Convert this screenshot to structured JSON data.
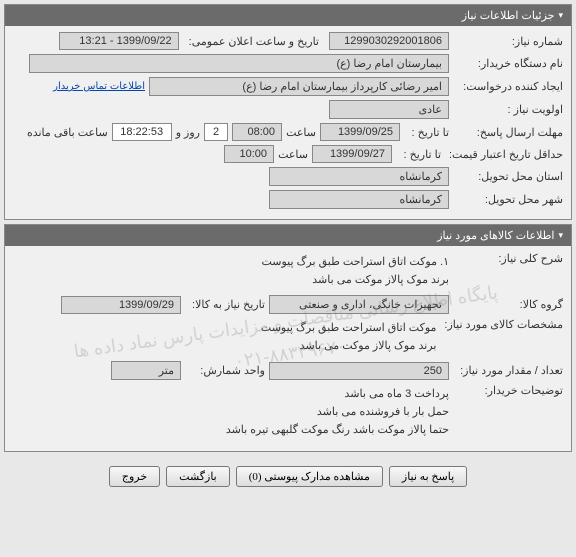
{
  "panel1": {
    "title": "جزئیات اطلاعات نیاز",
    "rows": {
      "req_no_label": "شماره نیاز:",
      "req_no_value": "1299030292001806",
      "pub_time_label": "تاریخ و ساعت اعلان عمومی:",
      "pub_time_value": "1399/09/22 - 13:21",
      "buyer_label": "نام دستگاه خریدار:",
      "buyer_value": "بیمارستان امام رضا (ع)",
      "creator_label": "ایجاد کننده درخواست:",
      "creator_value": "امیر رضائی کارپرداز بیمارستان امام رضا (ع)",
      "contact_link": "اطلاعات تماس خریدار",
      "priority_label": "اولویت نیاز :",
      "priority_value": "عادی",
      "deadline_label": "مهلت ارسال پاسخ:",
      "deadline_to": "تا تاریخ :",
      "deadline_date": "1399/09/25",
      "deadline_time_label": "ساعت",
      "deadline_time": "08:00",
      "remain_days": "2",
      "remain_day_label": "روز و",
      "remain_time": "18:22:53",
      "remain_suffix": "ساعت باقی مانده",
      "validity_label": "حداقل تاریخ اعتبار قیمت:",
      "validity_to": "تا تاریخ :",
      "validity_date": "1399/09/27",
      "validity_time_label": "ساعت",
      "validity_time": "10:00",
      "province_label": "استان محل تحویل:",
      "province_value": "کرمانشاه",
      "city_label": "شهر محل تحویل:",
      "city_value": "کرمانشاه"
    }
  },
  "panel2": {
    "title": "اطلاعات کالاهای مورد نیاز",
    "rows": {
      "desc_label": "شرح کلی نیاز:",
      "desc_line1": "۱. موکت اتاق استراحت طبق برگ پیوست",
      "desc_line2": "برند موک پالاز موکت می باشد",
      "group_label": "گروه کالا:",
      "group_value": "تجهیزات خانگی، اداری و صنعتی",
      "need_date_label": "تاریخ نیاز به کالا:",
      "need_date_value": "1399/09/29",
      "spec_label": "مشخصات کالای مورد نیاز:",
      "spec_line1": "موکت اتاق استراحت طبق برگ پیوست",
      "spec_line2": "برند موک پالاز موکت می باشد",
      "qty_label": "تعداد / مقدار مورد نیاز:",
      "qty_value": "250",
      "unit_label": "واحد شمارش:",
      "unit_value": "متر",
      "notes_label": "توضیحات خریدار:",
      "notes_line1": "پرداخت 3 ماه می باشد",
      "notes_line2": "حمل بار با فروشنده می باشد",
      "notes_line3": "حتما پالاز موکت باشد رنگ موکت گلبهی تیره باشد"
    }
  },
  "watermark": {
    "line1": "پایگاه اطلاع رسانی مناقصات و مزایدات پارس نماد داده ها",
    "line2": "۰۲۱-۸۸۳۴۹۶۷۰"
  },
  "actions": {
    "reply": "پاسخ به نیاز",
    "attachments": "مشاهده مدارک پیوستی (0)",
    "back": "بازگشت",
    "exit": "خروج"
  }
}
